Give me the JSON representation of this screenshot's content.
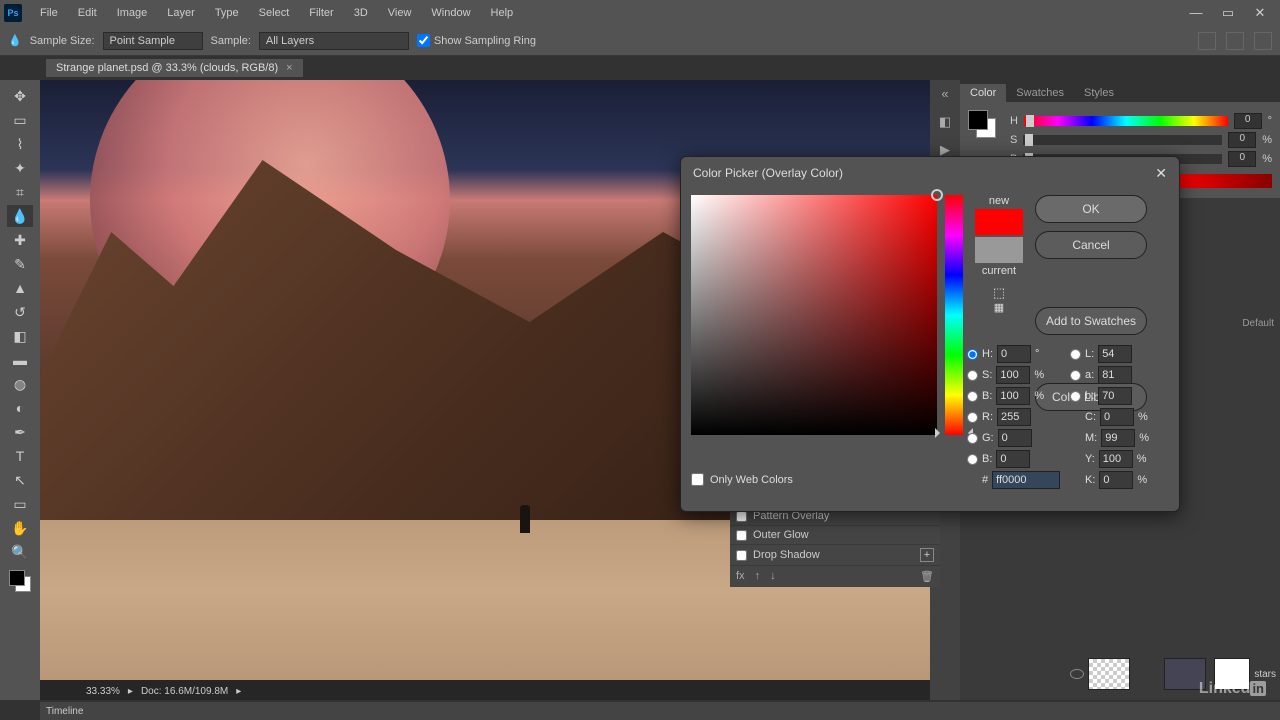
{
  "menu": {
    "items": [
      "File",
      "Edit",
      "Image",
      "Layer",
      "Type",
      "Select",
      "Filter",
      "3D",
      "View",
      "Window",
      "Help"
    ]
  },
  "optionsbar": {
    "sample_size_lbl": "Sample Size:",
    "sample_size_val": "Point Sample",
    "sample_lbl": "Sample:",
    "sample_val": "All Layers",
    "show_ring": "Show Sampling Ring"
  },
  "document": {
    "tab_title": "Strange planet.psd @ 33.3% (clouds, RGB/8)",
    "tab_close": "×"
  },
  "statusbar": {
    "zoom": "33.33%",
    "docsize": "Doc: 16.6M/109.8M"
  },
  "colorpanel": {
    "tabs": [
      "Color",
      "Swatches",
      "Styles"
    ],
    "H": "H",
    "S": "S",
    "B": "B",
    "h_val": "0",
    "s_val": "0",
    "b_val": "0",
    "pct": "%"
  },
  "rmid": {
    "default_btn": "Default"
  },
  "picker": {
    "title": "Color Picker (Overlay Color)",
    "close": "✕",
    "new_lbl": "new",
    "current_lbl": "current",
    "ok": "OK",
    "cancel": "Cancel",
    "add_swatches": "Add to Swatches",
    "color_libs": "Color Libraries",
    "owc": "Only Web Colors",
    "H": "H:",
    "S": "S:",
    "B": "B:",
    "R": "R:",
    "G": "G:",
    "Bch": "B:",
    "L": "L:",
    "a": "a:",
    "b": "b:",
    "C": "C:",
    "M": "M:",
    "Y": "Y:",
    "K": "K:",
    "hash": "#",
    "hex": "ff0000",
    "deg": "°",
    "pct": "%",
    "vals": {
      "H": "0",
      "S": "100",
      "Bv": "100",
      "R": "255",
      "G": "0",
      "Bc": "0",
      "L": "54",
      "a": "81",
      "b": "70",
      "C": "0",
      "M": "99",
      "Y": "100",
      "K": "0"
    }
  },
  "layerstyle": {
    "items": [
      "Pattern Overlay",
      "Outer Glow",
      "Drop Shadow"
    ],
    "fx": "fx",
    "up": "↑",
    "dn": "↓",
    "del": "🗑"
  },
  "layers": {
    "star_name": "stars"
  },
  "timeline": {
    "label": "Timeline"
  },
  "watermark": {
    "txt": "Linked",
    "in": "in"
  }
}
